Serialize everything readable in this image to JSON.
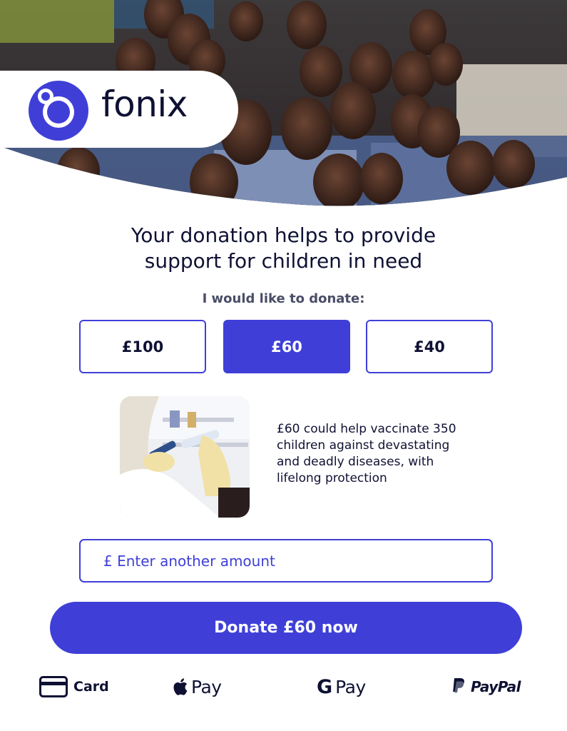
{
  "brand": {
    "name": "fonix",
    "color": "#3f3fd8"
  },
  "headline": {
    "line1": "Your donation helps to provide",
    "line2": "support for children in need"
  },
  "subhead": "I would like to donate:",
  "amounts": [
    {
      "label": "£100",
      "selected": false
    },
    {
      "label": "£60",
      "selected": true
    },
    {
      "label": "£40",
      "selected": false
    }
  ],
  "impact": {
    "line1": "£60 could help vaccinate 350",
    "line2": "children against devastating",
    "line3": "and deadly diseases, with",
    "line4": "lifelong protection"
  },
  "custom_amount": {
    "placeholder": "£ Enter another amount"
  },
  "donate_button": "Donate £60 now",
  "payment_methods": {
    "card": "Card",
    "apple_pay": "Pay",
    "google_pay": "Pay",
    "google_letter": "G",
    "paypal": "PayPal"
  },
  "icons": {
    "card": "credit-card-icon",
    "apple": "apple-icon",
    "google": "google-icon",
    "paypal": "paypal-icon"
  }
}
